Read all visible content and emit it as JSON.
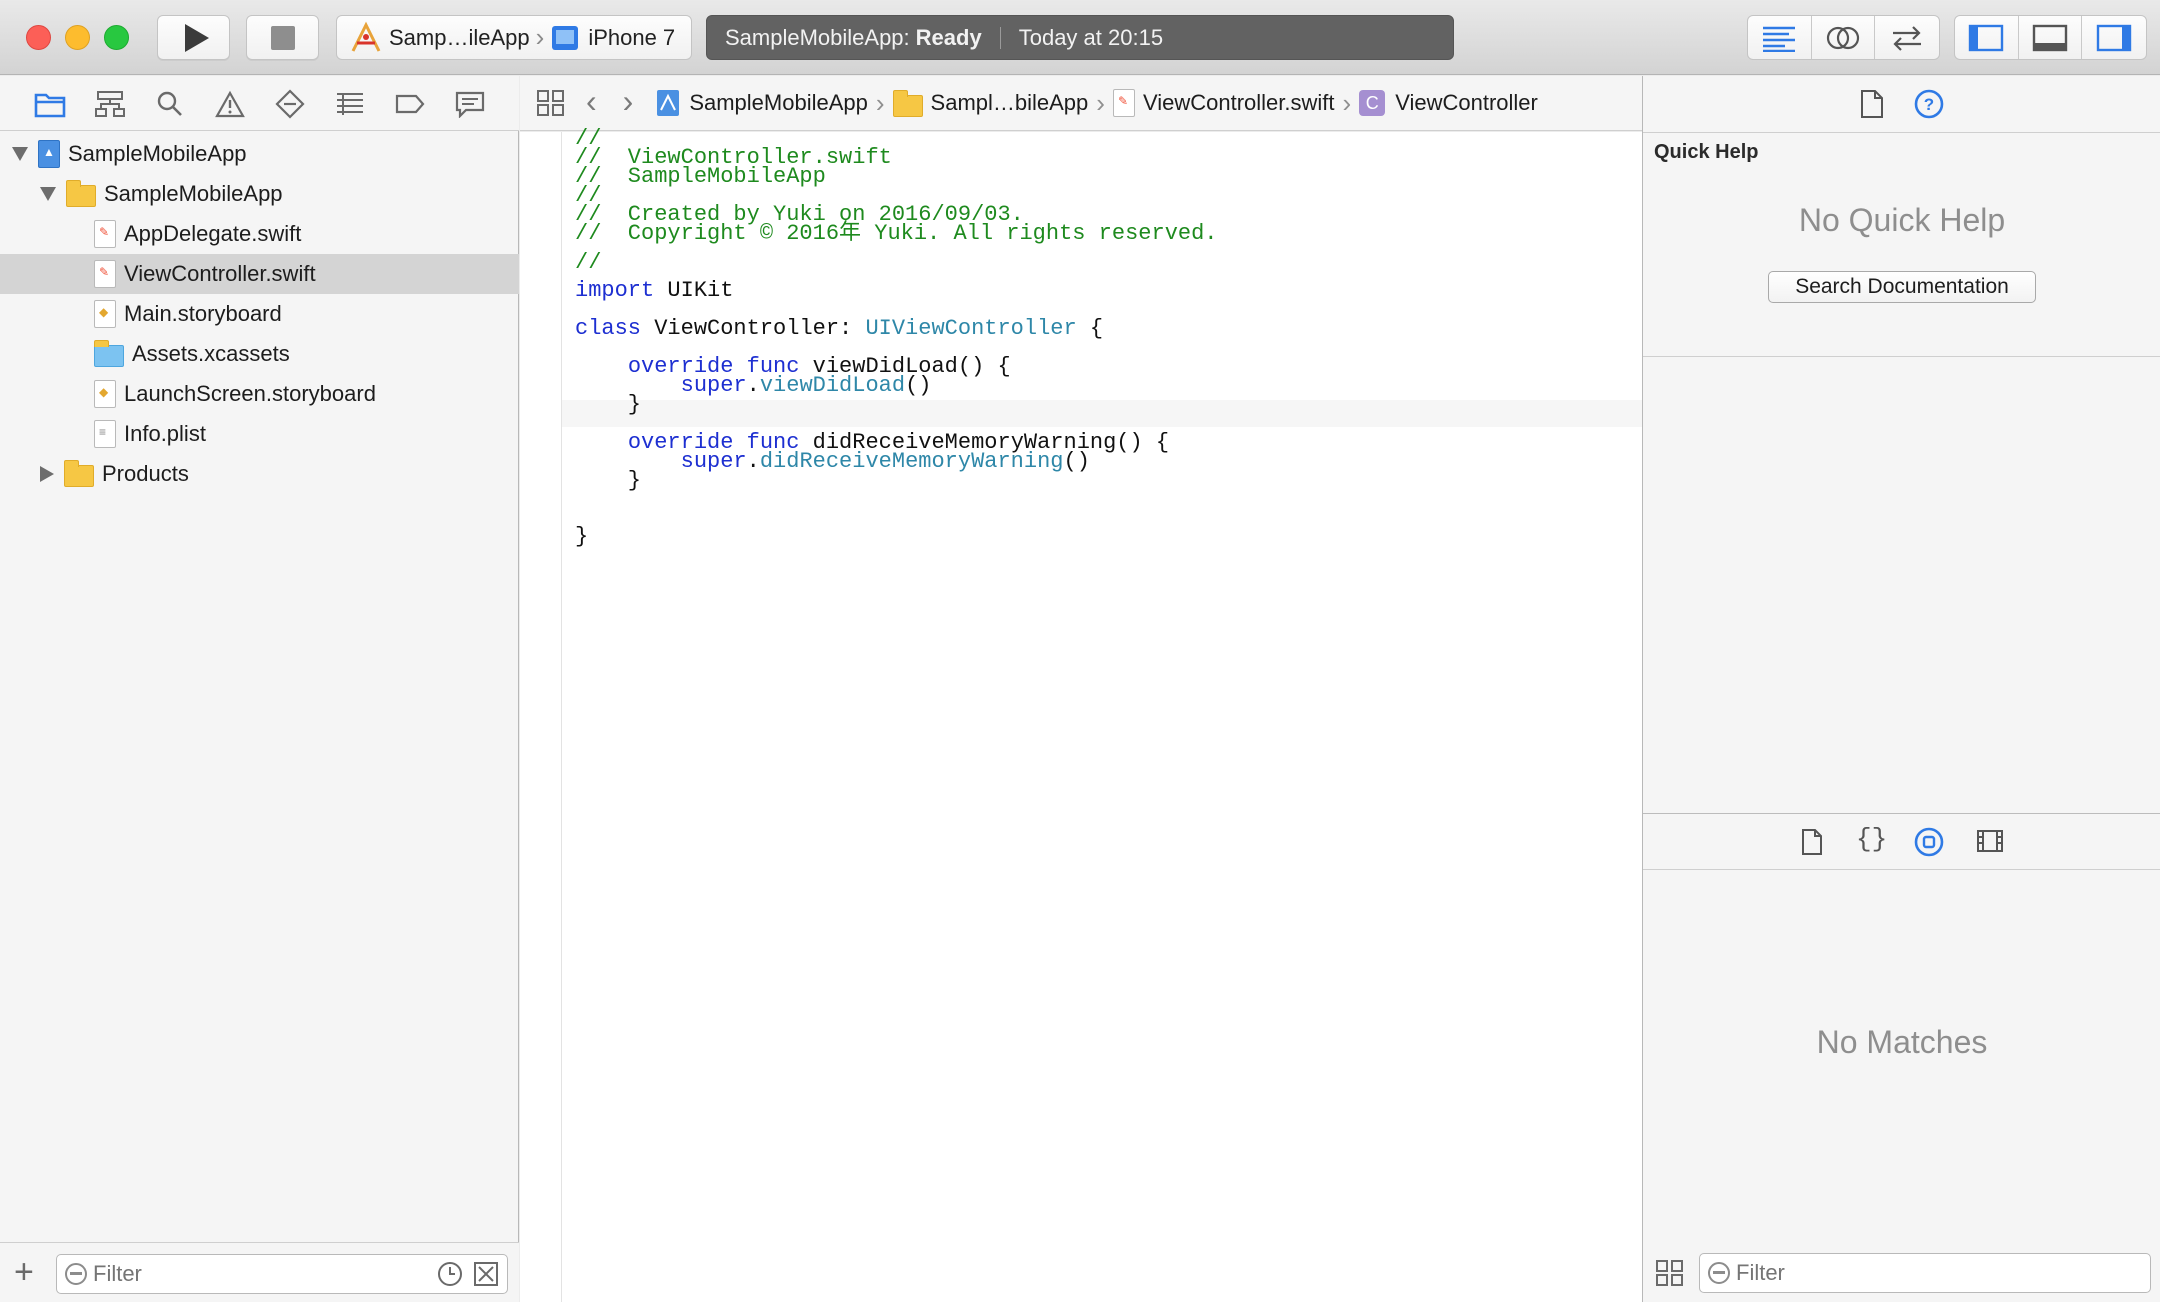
{
  "toolbar": {
    "scheme_name": "Samp…ileApp",
    "device": "iPhone 7",
    "status_app": "SampleMobileApp:",
    "status_state": "Ready",
    "status_time": "Today at 20:15"
  },
  "navigator": {
    "tree": [
      {
        "label": "SampleMobileApp",
        "kind": "project",
        "level": 0,
        "disclosure": "open",
        "selected": false
      },
      {
        "label": "SampleMobileApp",
        "kind": "folder",
        "level": 1,
        "disclosure": "open",
        "selected": false
      },
      {
        "label": "AppDelegate.swift",
        "kind": "swift",
        "level": 2,
        "selected": false
      },
      {
        "label": "ViewController.swift",
        "kind": "swift",
        "level": 2,
        "selected": true
      },
      {
        "label": "Main.storyboard",
        "kind": "storyboard",
        "level": 2,
        "selected": false
      },
      {
        "label": "Assets.xcassets",
        "kind": "assets",
        "level": 2,
        "selected": false
      },
      {
        "label": "LaunchScreen.storyboard",
        "kind": "storyboard",
        "level": 2,
        "selected": false
      },
      {
        "label": "Info.plist",
        "kind": "plist",
        "level": 2,
        "selected": false
      },
      {
        "label": "Products",
        "kind": "folder",
        "level": 1,
        "disclosure": "closed",
        "selected": false
      }
    ],
    "filter_placeholder": "Filter"
  },
  "jumpbar": {
    "crumbs": [
      "SampleMobileApp",
      "Sampl…bileApp",
      "ViewController.swift",
      "ViewController"
    ]
  },
  "editor": {
    "lines": [
      [
        [
          "cm",
          "//"
        ]
      ],
      [
        [
          "cm",
          "//  ViewController.swift"
        ]
      ],
      [
        [
          "cm",
          "//  SampleMobileApp"
        ]
      ],
      [
        [
          "cm",
          "//"
        ]
      ],
      [
        [
          "cm",
          "//  Created by Yuki on 2016/09/03."
        ]
      ],
      [
        [
          "cm",
          "//  Copyright © 2016年 Yuki. All rights reserved."
        ]
      ],
      [
        [
          "cm",
          "//"
        ]
      ],
      [],
      [
        [
          "kw",
          "import"
        ],
        [
          "pl",
          " UIKit"
        ]
      ],
      [],
      [
        [
          "kw",
          "class"
        ],
        [
          "pl",
          " ViewController: "
        ],
        [
          "ty",
          "UIViewController"
        ],
        [
          "pl",
          " {"
        ]
      ],
      [],
      [
        [
          "pl",
          "    "
        ],
        [
          "kw",
          "override"
        ],
        [
          "pl",
          " "
        ],
        [
          "kw",
          "func"
        ],
        [
          "pl",
          " viewDidLoad() {"
        ]
      ],
      [
        [
          "pl",
          "        "
        ],
        [
          "kw",
          "super"
        ],
        [
          "pl",
          "."
        ],
        [
          "fn",
          "viewDidLoad"
        ],
        [
          "pl",
          "()"
        ]
      ],
      [
        [
          "pl",
          "    }"
        ]
      ],
      [],
      [
        [
          "pl",
          "    "
        ],
        [
          "kw",
          "override"
        ],
        [
          "pl",
          " "
        ],
        [
          "kw",
          "func"
        ],
        [
          "pl",
          " didReceiveMemoryWarning() {"
        ]
      ],
      [
        [
          "pl",
          "        "
        ],
        [
          "kw",
          "super"
        ],
        [
          "pl",
          "."
        ],
        [
          "fn",
          "didReceiveMemoryWarning"
        ],
        [
          "pl",
          "()"
        ]
      ],
      [
        [
          "pl",
          "    }"
        ]
      ],
      [],
      [],
      [
        [
          "pl",
          "}"
        ]
      ]
    ]
  },
  "inspector": {
    "quick_help_title": "Quick Help",
    "no_quick_help": "No Quick Help",
    "search_documentation": "Search Documentation",
    "no_matches": "No Matches",
    "filter_placeholder": "Filter"
  },
  "colors": {
    "accent": "#2f7ae5",
    "comment": "#1e8a1e",
    "keyword": "#1d2fd1",
    "type": "#2e87a8"
  }
}
